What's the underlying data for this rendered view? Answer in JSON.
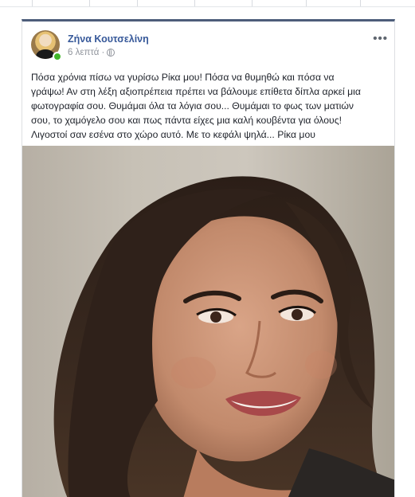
{
  "post": {
    "author": "Ζήνα Κουτσελίνη",
    "time": "6 λεπτά",
    "separator": "·",
    "more_label": "•••",
    "text_lines": [
      "Πόσα χρόνια πίσω να γυρίσω Ρίκα μου! Πόσα να θυμηθώ και πόσα να",
      "γράψω! Αν στη λέξη αξιοπρέπεια πρέπει να βάλουμε επίθετα δίπλα αρκεί μια",
      "φωτογραφία σου. Θυμάμαι όλα τα λόγια σου... Θυμάμαι το φως των ματιών",
      "σου, το χαμόγελο σου και πως πάντα είχες μια καλή κουβέντα για όλους!",
      "Λιγοστοί σαν εσένα στο χώρο αυτό. Με το κεφάλι ψηλά... Ρίκα μου"
    ]
  },
  "icons": {
    "privacy": "globe-icon",
    "status": "online-status-icon",
    "menu": "more-options-icon"
  },
  "colors": {
    "author_link": "#365899",
    "meta_text": "#90949c",
    "online": "#42b72a",
    "card_accent": "#4d5d7a"
  }
}
